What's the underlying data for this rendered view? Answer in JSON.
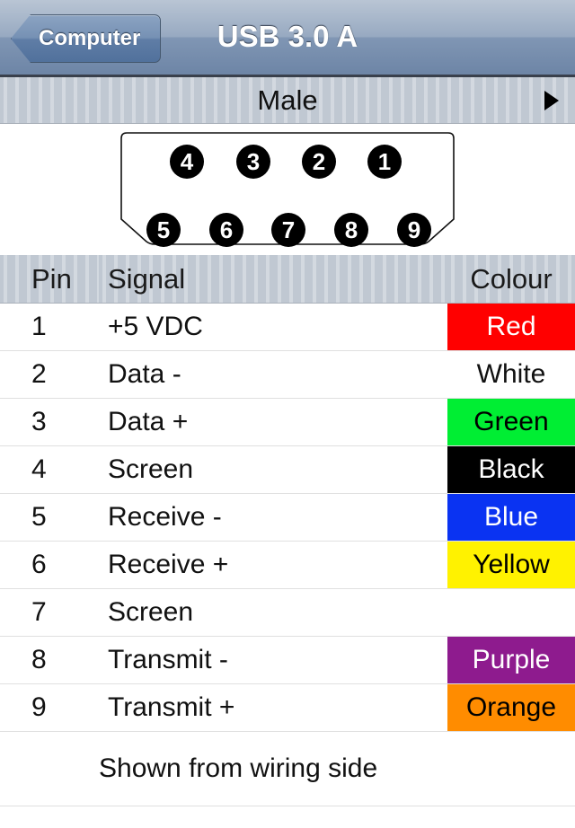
{
  "navbar": {
    "back_label": "Computer",
    "back_icon": "chevron-left-icon",
    "title": "USB 3.0 A"
  },
  "subheader": {
    "title": "Male",
    "next_icon": "triangle-right-icon"
  },
  "diagram": {
    "caption": "usb-3-0-a-male-connector-trapezoid",
    "top_row_pins": [
      "4",
      "3",
      "2",
      "1"
    ],
    "bottom_row_pins": [
      "5",
      "6",
      "7",
      "8",
      "9"
    ]
  },
  "table": {
    "headers": {
      "pin": "Pin",
      "signal": "Signal",
      "colour": "Colour"
    },
    "rows": [
      {
        "pin": "1",
        "signal": "+5 VDC",
        "colour": "Red",
        "bg": "#FF0000",
        "fg": "#FFFFFF"
      },
      {
        "pin": "2",
        "signal": "Data -",
        "colour": "White",
        "bg": "#FFFFFF",
        "fg": "#111111"
      },
      {
        "pin": "3",
        "signal": "Data +",
        "colour": "Green",
        "bg": "#00EE33",
        "fg": "#000000"
      },
      {
        "pin": "4",
        "signal": "Screen",
        "colour": "Black",
        "bg": "#000000",
        "fg": "#FFFFFF"
      },
      {
        "pin": "5",
        "signal": "Receive -",
        "colour": "Blue",
        "bg": "#0A33F2",
        "fg": "#FFFFFF"
      },
      {
        "pin": "6",
        "signal": "Receive +",
        "colour": "Yellow",
        "bg": "#FFF200",
        "fg": "#000000"
      },
      {
        "pin": "7",
        "signal": "Screen",
        "colour": "",
        "bg": "#FFFFFF",
        "fg": "#111111"
      },
      {
        "pin": "8",
        "signal": "Transmit -",
        "colour": "Purple",
        "bg": "#8E1B8E",
        "fg": "#FFFFFF"
      },
      {
        "pin": "9",
        "signal": "Transmit +",
        "colour": "Orange",
        "bg": "#FF8C00",
        "fg": "#000000"
      }
    ],
    "footer_note": "Shown from wiring side"
  },
  "colors": {
    "navbar_top": "#b9c5d4",
    "navbar_bottom": "#6d85a6",
    "subbar_bg": "#c0c8d2",
    "row_divider": "#e0e0e0"
  }
}
